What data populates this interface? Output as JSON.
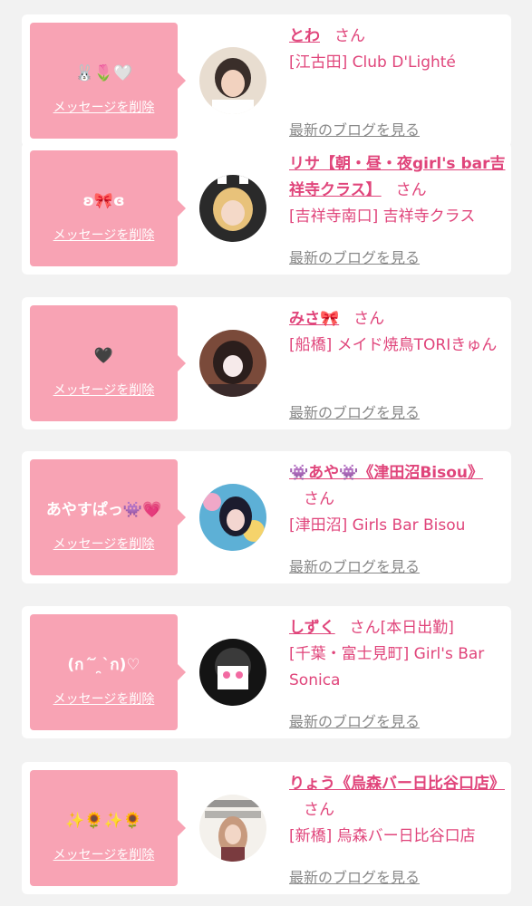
{
  "favorites": [
    {
      "message": "🐰🌷🤍",
      "delete_label": "メッセージを削除",
      "name": "とわ",
      "suffix": "さん",
      "status": "",
      "area": "[江古田] Club D'Lighté",
      "blog_label": "最新のブログを見る",
      "avatar_colors": [
        "#e8ddd0",
        "#3a2e2a",
        "#f2d2bf"
      ]
    },
    {
      "message": "ʚ🎀ɞ",
      "delete_label": "メッセージを削除",
      "name": "リサ【朝・昼・夜girl's bar吉祥寺クラス】",
      "suffix": "さん",
      "status": "",
      "area": "[吉祥寺南口] 吉祥寺クラス",
      "blog_label": "最新のブログを見る",
      "avatar_colors": [
        "#2a2a2a",
        "#e8c27a",
        "#f4d9c8"
      ]
    },
    {
      "message": "🖤",
      "delete_label": "メッセージを削除",
      "name": "みさ🎀",
      "suffix": "さん",
      "status": "",
      "area": "[船橋] メイド焼鳥TORIきゅん",
      "blog_label": "最新のブログを見る",
      "avatar_colors": [
        "#7a4a3a",
        "#2b1e1c",
        "#f6eaea"
      ]
    },
    {
      "message": "あやすぱっ👾💗",
      "delete_label": "メッセージを削除",
      "name": "👾あや👾《津田沼Bisou》",
      "suffix": "さん",
      "status": "",
      "area": "[津田沼] Girls Bar Bisou",
      "blog_label": "最新のブログを見る",
      "avatar_colors": [
        "#5db0d6",
        "#1c1c2e",
        "#f3d6d0"
      ]
    },
    {
      "message": "(ก´ ᷄ ̯`ก)♡",
      "delete_label": "メッセージを削除",
      "name": "しずく",
      "suffix": "さん",
      "status": "[本日出勤]",
      "area": "[千葉・富士見町] Girl's Bar Sonica",
      "blog_label": "最新のブログを見る",
      "avatar_colors": [
        "#141414",
        "#3a3a3a",
        "#ffffff"
      ]
    },
    {
      "message": "✨🌻✨🌻",
      "delete_label": "メッセージを削除",
      "name": "りょう《烏森バー日比谷口店》",
      "suffix": "さん",
      "status": "",
      "area": "[新橋] 烏森バー日比谷口店",
      "blog_label": "最新のブログを見る",
      "avatar_colors": [
        "#f4f1ec",
        "#c79a7e",
        "#7a3b3f"
      ]
    }
  ]
}
